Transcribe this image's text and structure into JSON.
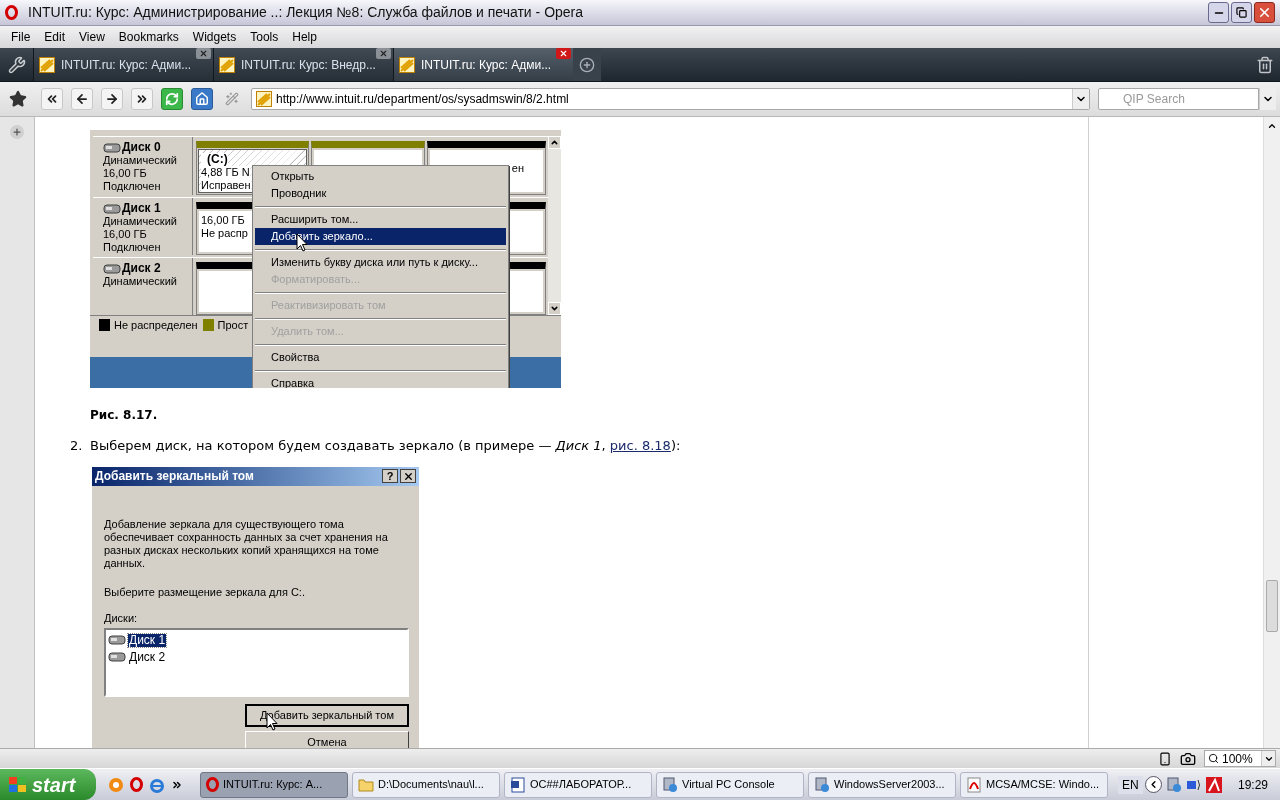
{
  "window": {
    "title": "INTUIT.ru: Курс: Администрирование ..: Лекция №8: Служба файлов и печати - Opera"
  },
  "menu": [
    "File",
    "Edit",
    "View",
    "Bookmarks",
    "Widgets",
    "Tools",
    "Help"
  ],
  "tabs": [
    {
      "label": "INTUIT.ru: Курс: Адми...",
      "selected": false
    },
    {
      "label": "INTUIT.ru: Курс: Внедр...",
      "selected": false
    },
    {
      "label": "INTUIT.ru: Курс: Адми...",
      "selected": true
    }
  ],
  "address": {
    "url": "http://www.intuit.ru/department/os/sysadmswin/8/2.html"
  },
  "search": {
    "placeholder": "QIP Search"
  },
  "figure": {
    "disks": [
      {
        "name": "Диск 0",
        "lines": [
          "Динамический",
          "16,00 ГБ",
          "Подключен"
        ],
        "volumes": [
          {
            "label": "(C:)",
            "lines": [
              "4,88 ГБ N",
              "Исправен"
            ],
            "color": "#808000",
            "selected": true
          },
          {
            "color": "#808000",
            "selected": false
          },
          {
            "lines": [
              "ен"
            ],
            "color": "#000000",
            "selected": false
          }
        ]
      },
      {
        "name": "Диск 1",
        "lines": [
          "Динамический",
          "16,00 ГБ",
          "Подключен"
        ],
        "volumes": [
          {
            "lines": [
              "16,00 ГБ",
              "Не распр"
            ],
            "color": "#000000",
            "selected": false
          }
        ]
      },
      {
        "name": "Диск 2",
        "lines": [
          "Динамический"
        ],
        "volumes": [
          {
            "color": "#000000",
            "selected": false
          }
        ]
      }
    ],
    "legend": [
      {
        "label": "Не распределен",
        "color": "#000000"
      },
      {
        "label": "Прост",
        "color": "#808000"
      }
    ],
    "context_menu": [
      {
        "kind": "item",
        "label": "Открыть",
        "disabled": false,
        "selected": false
      },
      {
        "kind": "item",
        "label": "Проводник",
        "disabled": false,
        "selected": false
      },
      {
        "kind": "separator"
      },
      {
        "kind": "item",
        "label": "Расширить том...",
        "disabled": false,
        "selected": false
      },
      {
        "kind": "item",
        "label": "Добавить зеркало...",
        "disabled": false,
        "selected": true
      },
      {
        "kind": "separator"
      },
      {
        "kind": "item",
        "label": "Изменить букву диска или путь к диску...",
        "disabled": false,
        "selected": false
      },
      {
        "kind": "item",
        "label": "Форматировать...",
        "disabled": true,
        "selected": false
      },
      {
        "kind": "separator"
      },
      {
        "kind": "item",
        "label": "Реактивизировать том",
        "disabled": true,
        "selected": false
      },
      {
        "kind": "separator"
      },
      {
        "kind": "item",
        "label": "Удалить том...",
        "disabled": true,
        "selected": false
      },
      {
        "kind": "separator"
      },
      {
        "kind": "item",
        "label": "Свойства",
        "disabled": false,
        "selected": false
      },
      {
        "kind": "separator"
      },
      {
        "kind": "item",
        "label": "Справка",
        "disabled": false,
        "selected": false
      }
    ]
  },
  "caption": "Рис. 8.17.",
  "step": {
    "number": "2.",
    "text": "Выберем диск, на котором будем создавать зеркало (в примере — *Диск 1*, ",
    "link": "рис. 8.18",
    "after": "):"
  },
  "dialog": {
    "title": "Добавить зеркальный том",
    "help": "?",
    "description": "Добавление зеркала для существующего тома обеспечивает сохранность данных за счет хранения  на разных дисках нескольких копий хранящихся на томе данных.",
    "prompt": "Выберите размещение зеркала для С:.",
    "list_label": "Диски:",
    "disks": [
      {
        "label": "Диск 1",
        "selected": true
      },
      {
        "label": "Диск 2",
        "selected": false
      }
    ],
    "buttons": [
      "Добавить зеркальный том",
      "Отмена"
    ]
  },
  "status_bar": {
    "zoom": "100%"
  },
  "taskbar": {
    "start": "start",
    "tasks": [
      {
        "label": "INTUIT.ru: Курс: А...",
        "kind": "opera",
        "selected": true
      },
      {
        "label": "D:\\Documents\\nau\\l...",
        "kind": "folder",
        "selected": false
      },
      {
        "label": "ОС##ЛАБОРАТОР...",
        "kind": "word",
        "selected": false
      },
      {
        "label": "Virtual PC Console",
        "kind": "vpc",
        "selected": false
      },
      {
        "label": "WindowsServer2003...",
        "kind": "vpc",
        "selected": false
      },
      {
        "label": "MCSA/MCSE: Windo...",
        "kind": "pdf",
        "selected": false
      }
    ],
    "language": "EN",
    "clock": "19:29"
  }
}
